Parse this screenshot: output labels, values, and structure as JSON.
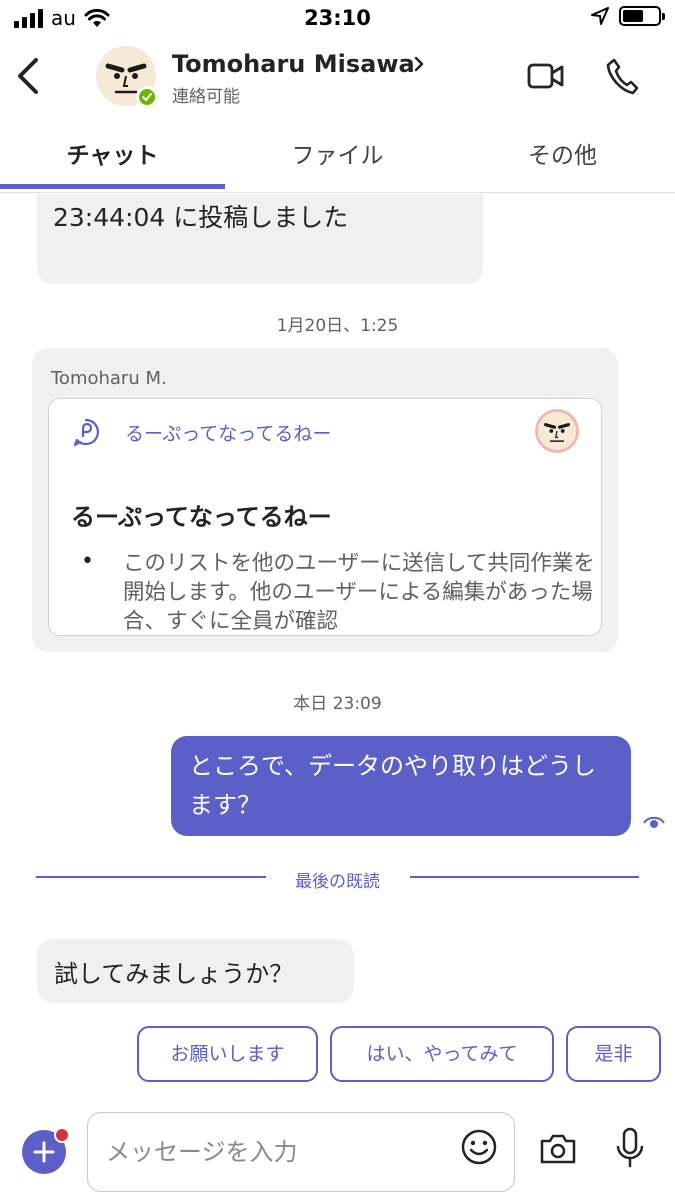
{
  "status_bar": {
    "carrier": "au",
    "time": "23:10"
  },
  "header": {
    "contact_name": "Tomoharu Misawa",
    "contact_status": "連絡可能",
    "presence_color": "#6bb700"
  },
  "tabs": [
    {
      "label": "チャット",
      "active": true
    },
    {
      "label": "ファイル",
      "active": false
    },
    {
      "label": "その他",
      "active": false
    }
  ],
  "messages": {
    "first_partial_text": "23:44:04 に投稿しました",
    "time_1": "1月20日、1:25",
    "card_message": {
      "sender": "Tomoharu M.",
      "app_label": "るーぷってなってるねー",
      "title": "るーぷってなってるねー",
      "bullet": "•",
      "body": "このリストを他のユーザーに送信して共同作業を開始します。他のユーザーによる編集があった場合、すぐに全員が確認"
    },
    "time_2": "本日 23:09",
    "outgoing_text": "ところで、データのやり取りはどうします？",
    "last_read_label": "最後の既読",
    "incoming_last": "試してみましょうか？"
  },
  "suggested_replies": [
    "お願いします",
    "はい、やってみて",
    "是非"
  ],
  "compose": {
    "placeholder": "メッセージを入力"
  },
  "colors": {
    "accent": "#5b5fc7",
    "bubble_in": "#f0f0f0",
    "notification": "#d13438"
  },
  "icons": {
    "back": "chevron-left-icon",
    "video": "video-camera-icon",
    "call": "phone-icon",
    "loop": "loop-icon",
    "read": "eye-icon",
    "add": "plus-icon",
    "emoji": "emoji-icon",
    "camera": "camera-icon",
    "mic": "microphone-icon"
  }
}
